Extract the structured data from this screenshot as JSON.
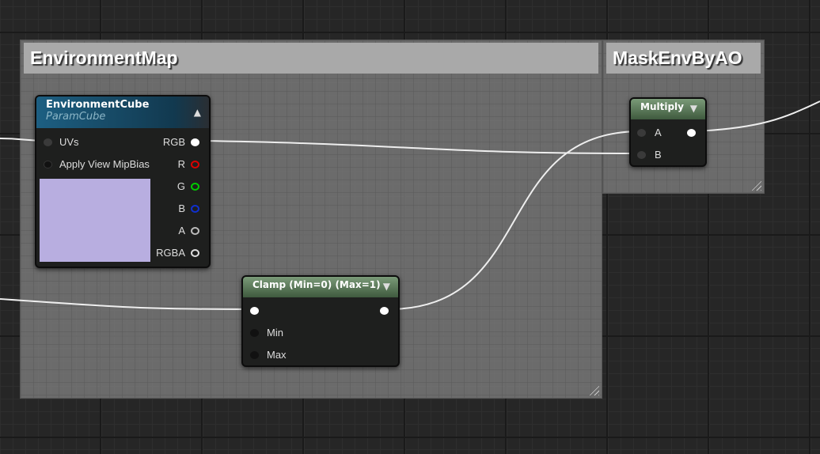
{
  "comments": [
    {
      "title": "EnvironmentMap"
    },
    {
      "title": "MaskEnvByAO"
    }
  ],
  "env_node": {
    "title": "EnvironmentCube",
    "subtitle": "ParamCube",
    "inputs": [
      "UVs",
      "Apply View MipBias"
    ],
    "outputs": [
      "RGB",
      "R",
      "G",
      "B",
      "A",
      "RGBA"
    ],
    "preview_color": "#b8aee0"
  },
  "clamp_node": {
    "title": "Clamp (Min=0) (Max=1)",
    "inputs": [
      "Min",
      "Max"
    ]
  },
  "multiply_node": {
    "title": "Multiply",
    "inputs": [
      "A",
      "B"
    ]
  }
}
